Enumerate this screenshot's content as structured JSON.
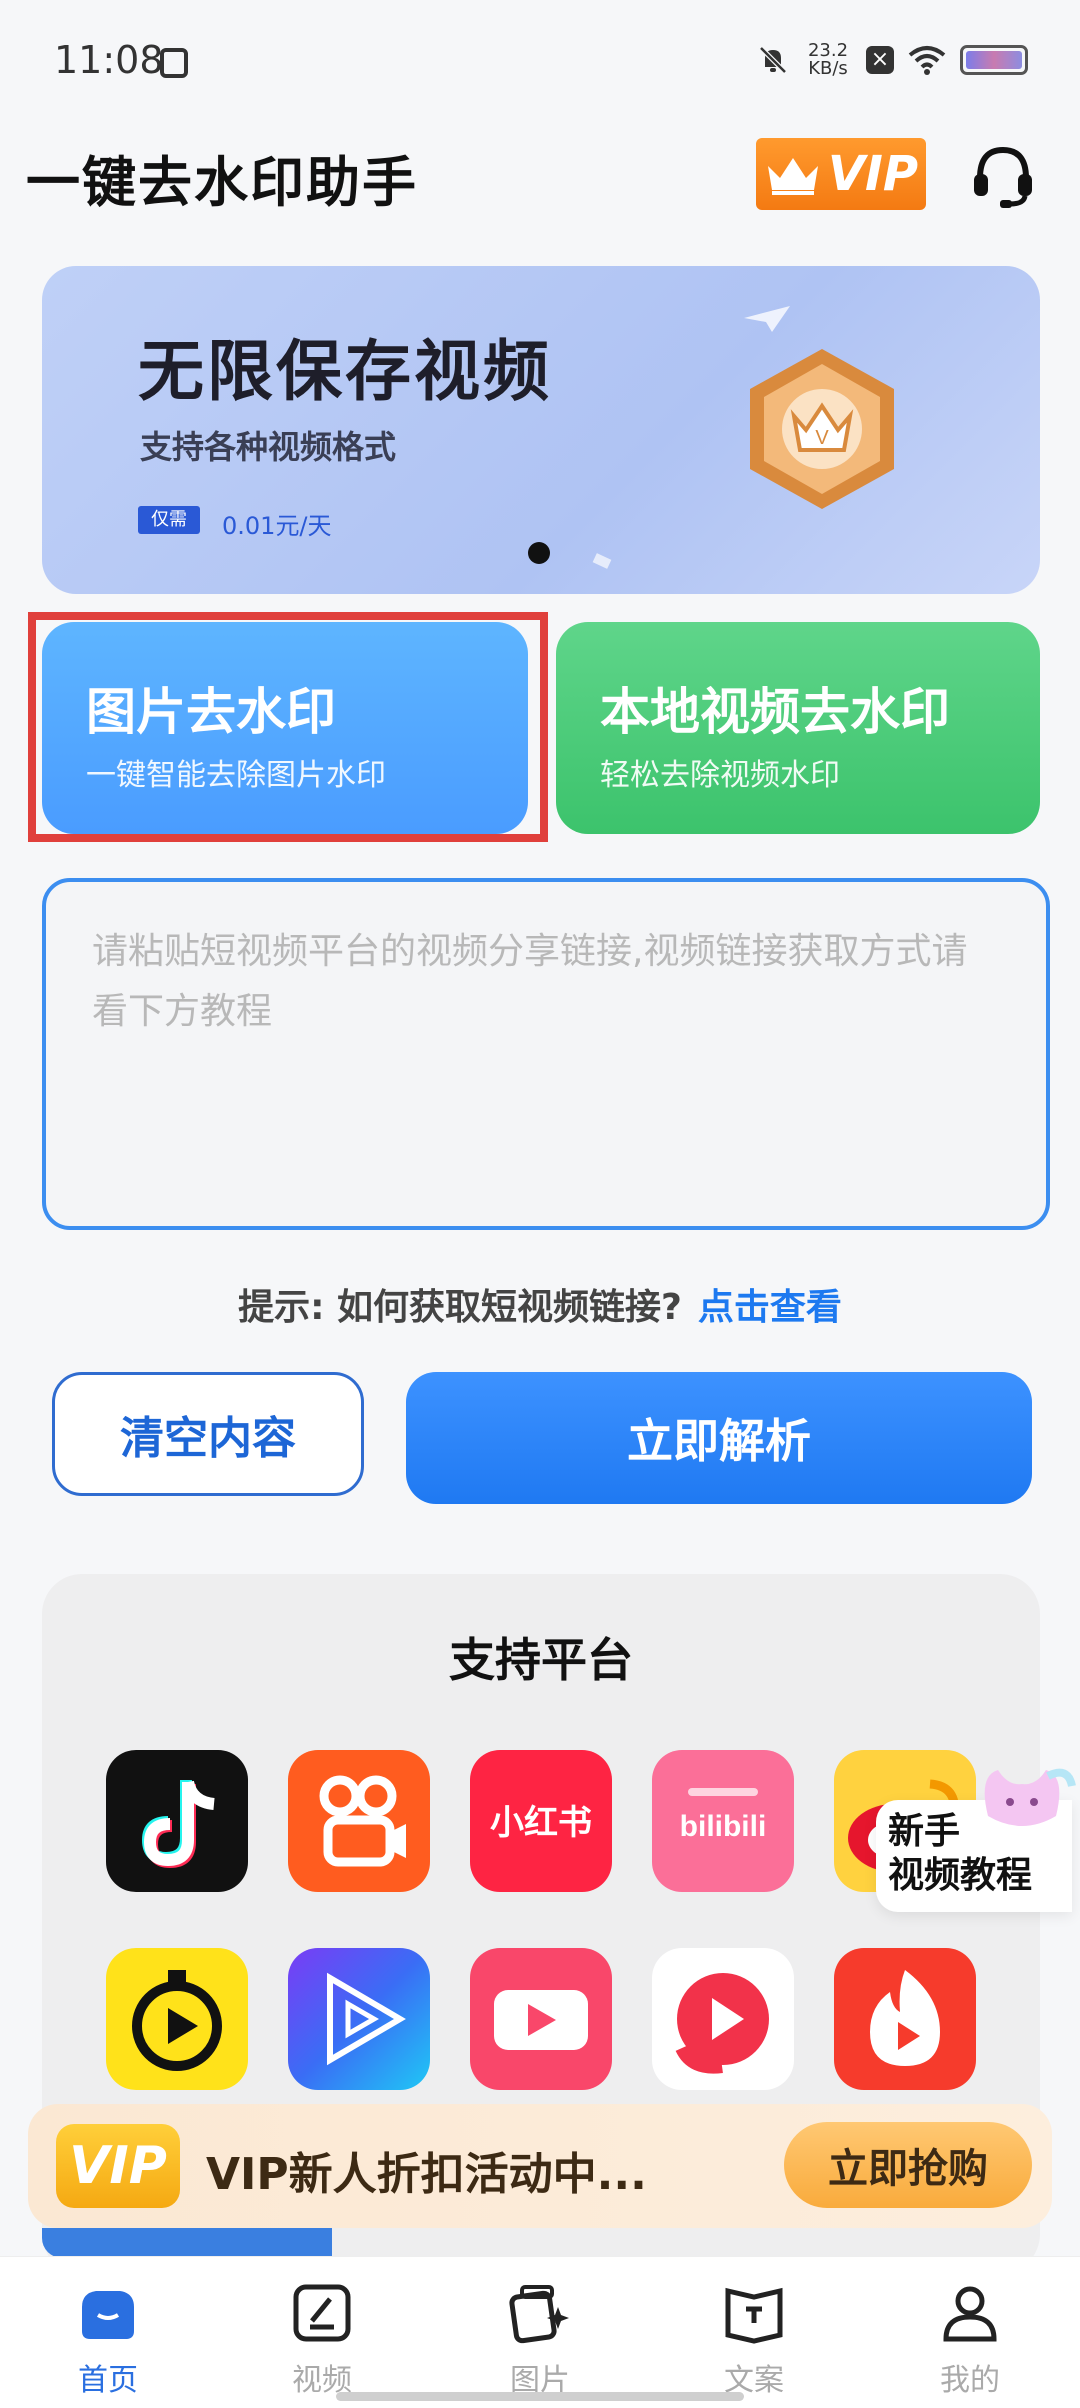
{
  "status_bar": {
    "time": "11:08",
    "speed_value": "23.2",
    "speed_unit": "KB/s"
  },
  "header": {
    "title": "一键去水印助手",
    "vip_label": "VIP",
    "icons": [
      "crown-icon",
      "headset-icon"
    ]
  },
  "banner": {
    "title": "无限保存视频",
    "subtitle": "支持各种视频格式",
    "tag": "仅需",
    "price": "0.01元/天"
  },
  "features": {
    "image": {
      "title": "图片去水印",
      "subtitle": "一键智能去除图片水印"
    },
    "video": {
      "title": "本地视频去水印",
      "subtitle": "轻松去除视频水印"
    }
  },
  "link_input": {
    "value": "",
    "placeholder": "请粘贴短视频平台的视频分享链接,视频链接获取方式请看下方教程"
  },
  "tip": {
    "text": "提示: 如何获取短视频链接?",
    "link": "点击查看"
  },
  "buttons": {
    "clear": "清空内容",
    "parse": "立即解析"
  },
  "platforms": {
    "title": "支持平台",
    "items": [
      "tiktok-icon",
      "kuaishou-icon",
      "xiaohongshu-icon",
      "bilibili-icon",
      "weibo-icon",
      "timer-video-icon",
      "play-prism-icon",
      "video-camera-icon",
      "red-play-icon",
      "flame-video-icon"
    ],
    "xiaohongshu_label": "小红书",
    "bilibili_label": "bilibili"
  },
  "tutorial": {
    "line1": "新手",
    "line2": "视频教程"
  },
  "promo": {
    "logo": "VIP",
    "text": "VIP新人折扣活动中...",
    "button": "立即抢购"
  },
  "nav": {
    "items": [
      {
        "label": "首页",
        "active": true
      },
      {
        "label": "视频",
        "active": false
      },
      {
        "label": "图片",
        "active": false
      },
      {
        "label": "文案",
        "active": false
      },
      {
        "label": "我的",
        "active": false
      }
    ]
  },
  "colors": {
    "accent": "#1d79f0",
    "highlight": "#e0403c",
    "image_card": "#4a9cff",
    "video_card": "#3cc36c",
    "vip_orange": "#f47a12"
  }
}
